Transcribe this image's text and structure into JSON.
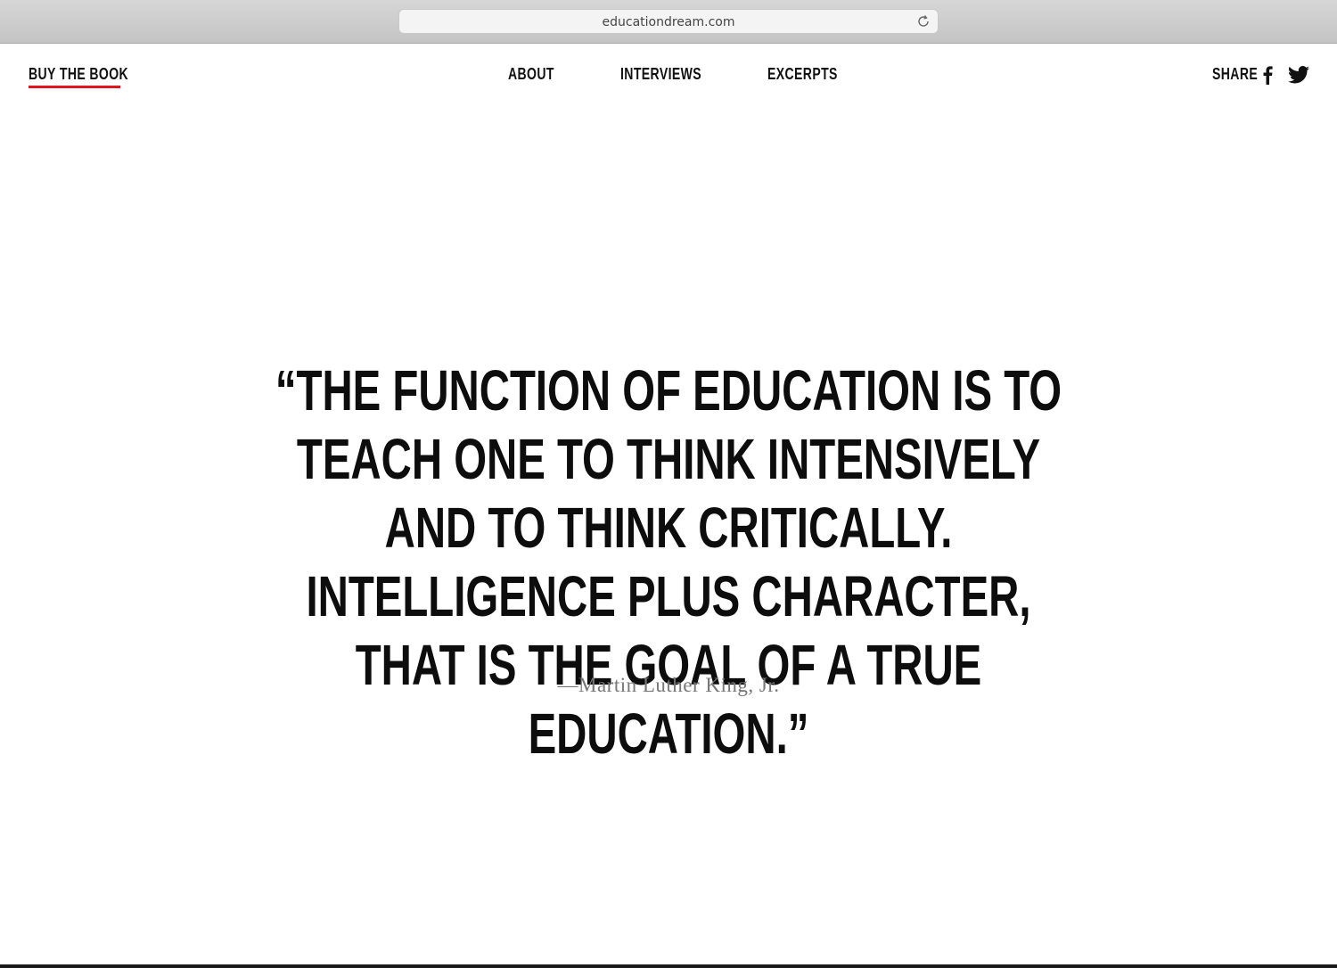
{
  "browser": {
    "url": "educationdream.com",
    "reload_icon": "reload-icon"
  },
  "header": {
    "buy_label": "BUY THE BOOK",
    "accent_color": "#e2141b",
    "nav": [
      {
        "label": "ABOUT"
      },
      {
        "label": "INTERVIEWS"
      },
      {
        "label": "EXCERPTS"
      }
    ],
    "share_label": "SHARE",
    "share_icons": [
      "facebook-icon",
      "twitter-icon"
    ]
  },
  "main": {
    "quote": "“THE FUNCTION OF EDUCATION IS TO TEACH ONE TO THINK INTENSIVELY AND TO THINK CRITICALLY. INTELLIGENCE PLUS CHARACTER, THAT IS THE GOAL OF A TRUE EDUCATION.”",
    "attribution": "—Martin Luther King, Jr."
  }
}
